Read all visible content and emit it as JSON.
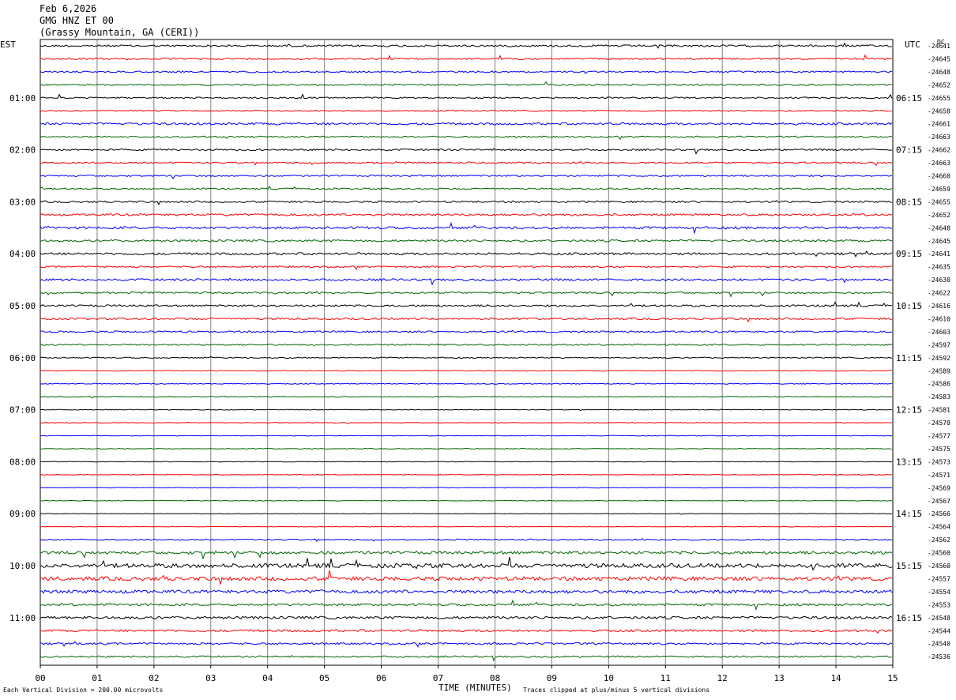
{
  "header": {
    "date": "Feb 6,2026",
    "station": "GMG HNZ ET 00",
    "location": "(Grassy Mountain, GA (CERI))"
  },
  "chart_data": {
    "type": "line",
    "title": "GMG HNZ ET 00",
    "left_timezone": "EST",
    "right_timezone": "UTC",
    "dc_header": "DC",
    "xlabel": "TIME (MINUTES)",
    "xlim": [
      0,
      15
    ],
    "x_ticks": [
      "00",
      "01",
      "02",
      "03",
      "04",
      "05",
      "06",
      "07",
      "08",
      "09",
      "10",
      "11",
      "12",
      "13",
      "14",
      "15"
    ],
    "trace_colors": [
      "#000000",
      "#ff0000",
      "#0000ff",
      "#006400"
    ],
    "trace_count": 48,
    "left_hour_labels": [
      "01:00",
      "02:00",
      "03:00",
      "04:00",
      "05:00",
      "06:00",
      "07:00",
      "08:00",
      "09:00",
      "10:00",
      "11:00"
    ],
    "right_hour_labels": [
      "06:15",
      "07:15",
      "08:15",
      "09:15",
      "10:15",
      "11:15",
      "12:15",
      "13:15",
      "14:15",
      "15:15",
      "16:15"
    ],
    "hour_label_trace_start": 4,
    "dc_offsets": [
      "-24641",
      "-24645",
      "-24648",
      "-24652",
      "-24655",
      "-24658",
      "-24661",
      "-24663",
      "-24662",
      "-24663",
      "-24660",
      "-24659",
      "-24655",
      "-24652",
      "-24648",
      "-24645",
      "-24641",
      "-24635",
      "-24630",
      "-24622",
      "-24616",
      "-24610",
      "-24603",
      "-24597",
      "-24592",
      "-24589",
      "-24586",
      "-24583",
      "-24581",
      "-24578",
      "-24577",
      "-24575",
      "-24573",
      "-24571",
      "-24569",
      "-24567",
      "-24566",
      "-24564",
      "-24562",
      "-24560",
      "-24560",
      "-24557",
      "-24554",
      "-24553",
      "-24548",
      "-24544",
      "-24540",
      "-24536"
    ],
    "noise_levels": [
      1.2,
      1.0,
      1.0,
      0.9,
      0.9,
      0.8,
      1.4,
      0.9,
      1.1,
      1.0,
      1.0,
      0.9,
      1.1,
      1.3,
      1.5,
      1.3,
      1.4,
      1.0,
      1.3,
      1.1,
      1.2,
      1.2,
      1.1,
      0.9,
      0.7,
      0.5,
      0.6,
      0.5,
      0.4,
      0.4,
      0.4,
      0.4,
      0.4,
      0.4,
      0.4,
      0.4,
      0.3,
      0.3,
      0.8,
      1.8,
      2.6,
      2.4,
      2.0,
      1.4,
      1.6,
      1.4,
      1.2,
      1.0
    ],
    "footer_left": "Each Vertical Division =  200.00 microvolts",
    "footer_right": "Traces clipped at plus/minus 5 vertical divisions"
  }
}
